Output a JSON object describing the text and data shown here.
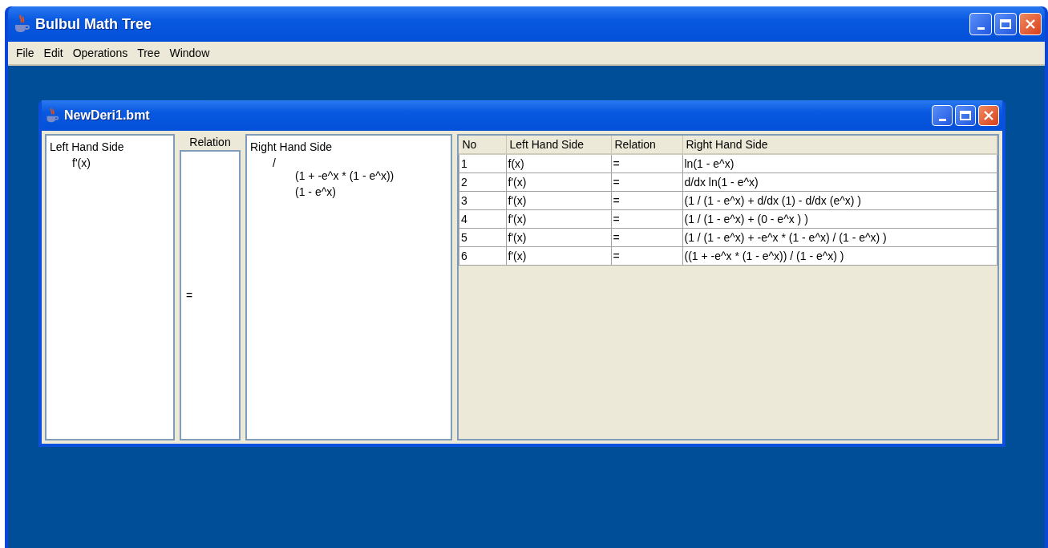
{
  "window": {
    "title": "Bulbul Math Tree"
  },
  "menu": [
    {
      "label": "File"
    },
    {
      "label": "Edit"
    },
    {
      "label": "Operations"
    },
    {
      "label": "Tree"
    },
    {
      "label": "Window"
    }
  ],
  "document": {
    "title": "NewDeri1.bmt",
    "left_tree": {
      "header": "Left Hand Side",
      "nodes": [
        {
          "label": "f'(x)"
        }
      ]
    },
    "relation": {
      "header": "Relation",
      "value": "="
    },
    "right_tree": {
      "header": "Right Hand Side",
      "nodes": [
        {
          "label": "/",
          "children": [
            {
              "label": "(1 + -e^x * (1 - e^x))"
            },
            {
              "label": "(1 - e^x)"
            }
          ]
        }
      ]
    },
    "table": {
      "columns": [
        "No",
        "Left Hand Side",
        "Relation",
        "Right Hand Side"
      ],
      "rows": [
        [
          "1",
          "f(x)",
          "=",
          "ln(1 - e^x)"
        ],
        [
          "2",
          "f'(x)",
          "=",
          "d/dx ln(1 - e^x)"
        ],
        [
          "3",
          "f'(x)",
          "=",
          "(1 / (1 - e^x) + d/dx (1) - d/dx (e^x) )"
        ],
        [
          "4",
          "f'(x)",
          "=",
          "(1 / (1 - e^x) + (0 - e^x ) )"
        ],
        [
          "5",
          "f'(x)",
          "=",
          "(1 / (1 - e^x) +  -e^x * (1 - e^x) / (1 - e^x) )"
        ],
        [
          "6",
          "f'(x)",
          "=",
          "((1 + -e^x * (1 - e^x)) / (1 - e^x) )"
        ]
      ]
    }
  }
}
